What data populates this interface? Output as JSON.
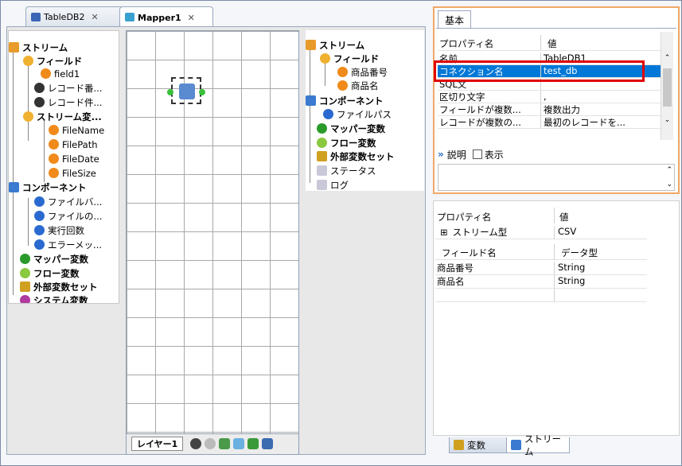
{
  "tabs": [
    {
      "label": "TableDB2"
    },
    {
      "label": "Mapper1"
    }
  ],
  "left_tree": {
    "stream": "ストリーム",
    "field": "フィールド",
    "field1": "field1",
    "record_num": "レコード番...",
    "record_count": "レコード件...",
    "stream_var": "ストリーム変...",
    "filename": "FileName",
    "filepath": "FilePath",
    "filedate": "FileDate",
    "filesize": "FileSize",
    "component": "コンポーネント",
    "file_b": "ファイルバ...",
    "file_no": "ファイルの...",
    "exec_count": "実行回数",
    "error_msg": "エラーメッ...",
    "mapper_var": "マッパー変数",
    "flow_var": "フロー変数",
    "ext_var_set": "外部変数セット",
    "system_var": "システム変数"
  },
  "canvas": {
    "layer_label": "レイヤー1"
  },
  "right_tree": {
    "stream": "ストリーム",
    "field": "フィールド",
    "product_no": "商品番号",
    "product_name": "商品名",
    "component": "コンポーネント",
    "file_path": "ファイルパス",
    "mapper_var": "マッパー変数",
    "flow_var": "フロー変数",
    "ext_var_set": "外部変数セット",
    "status": "ステータス",
    "log": "ログ"
  },
  "properties": {
    "tab": "基本",
    "header_name": "プロパティ名",
    "header_value": "値",
    "rows": [
      {
        "k": "名前",
        "v": "TableDB1"
      },
      {
        "k": "コネクション名",
        "v": "test_db"
      },
      {
        "k": "SQL文",
        "v": ""
      },
      {
        "k": "区切り文字",
        "v": ","
      },
      {
        "k": "フィールドが複数...",
        "v": "複数出力"
      },
      {
        "k": "レコードが複数の...",
        "v": "最初のレコードを..."
      }
    ],
    "desc_label": "説明",
    "show_label": "表示"
  },
  "stream_props": {
    "header_name": "プロパティ名",
    "header_value": "値",
    "stream_type_label": "ストリーム型",
    "stream_type_value": "CSV",
    "field_header": "フィールド名",
    "type_header": "データ型",
    "fields": [
      {
        "k": "商品番号",
        "v": "String"
      },
      {
        "k": "商品名",
        "v": "String"
      }
    ]
  },
  "bottom_tabs": [
    {
      "label": "変数"
    },
    {
      "label": "ストリーム"
    }
  ],
  "colors": {
    "selection": "#0078d7",
    "highlight": "#e00000",
    "panel_border": "#f0a868"
  }
}
